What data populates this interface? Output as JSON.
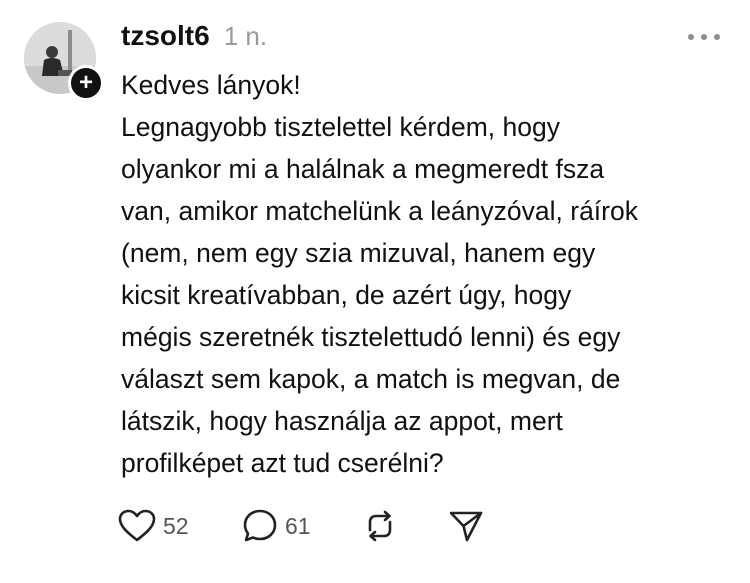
{
  "post": {
    "username": "tzsolt6",
    "time": "1 n.",
    "greeting": "Kedves lányok!",
    "body": "Legnagyobb tisztelettel kérdem, hogy\nolyankor mi a halálnak a megmeredt fsza\nvan, amikor matchelünk a leányzóval, ráírok\n(nem, nem egy szia mizuval, hanem egy\nkicsit kreatívabban, de azért úgy, hogy\nmégis szeretnék tisztelettudó lenni) és egy\nválaszt sem kapok, a match is megvan, de\nlátszik, hogy használja az appot, mert\nprofilképet azt tud cserélni?",
    "avatar_badge": "+",
    "likes": "52",
    "replies": "61"
  },
  "icons": {
    "more": "more-dots-icon",
    "like": "heart-icon",
    "reply": "comment-icon",
    "repost": "repost-icon",
    "share": "share-send-icon",
    "follow": "plus-icon"
  },
  "colors": {
    "text": "#111111",
    "muted": "#9a9a9a",
    "badge": "#111111",
    "background": "#ffffff"
  }
}
